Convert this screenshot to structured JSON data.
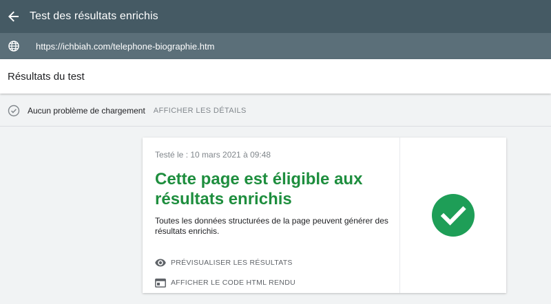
{
  "app": {
    "title": "Test des résultats enrichis",
    "url": "https://ichbiah.com/telephone-biographie.htm"
  },
  "results": {
    "title": "Résultats du test"
  },
  "status": {
    "text": "Aucun problème de chargement",
    "details_link": "AFFICHER LES DÉTAILS"
  },
  "card": {
    "tested": "Testé le : 10 mars 2021 à 09:48",
    "headline": "Cette page est éligible aux résultats enrichis",
    "description": "Toutes les données structurées de la page peuvent générer des résultats enrichis.",
    "actions": [
      {
        "label": "PRÉVISUALISER LES RÉSULTATS",
        "icon": "eye-icon"
      },
      {
        "label": "AFFICHER LE CODE HTML RENDU",
        "icon": "browser-window-icon"
      }
    ],
    "status_icon": "check-circle-icon"
  },
  "colors": {
    "topbar": "#455a64",
    "urlbar": "#5b6f79",
    "success": "#1e8e3e",
    "success_badge": "#1e9e57"
  }
}
